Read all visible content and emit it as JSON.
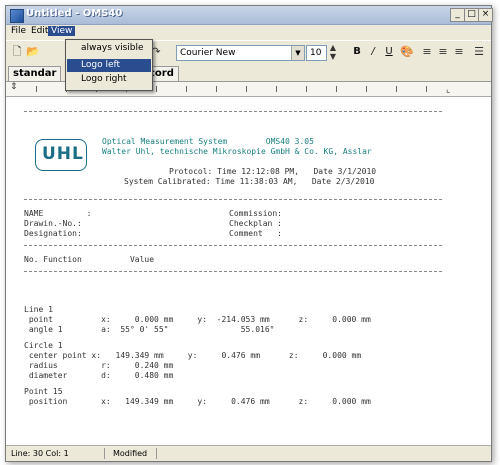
{
  "window": {
    "title": "Untitled - OMS40"
  },
  "window_buttons": [
    "_",
    "□",
    "×"
  ],
  "menu": {
    "file": "File",
    "edit": "Edit",
    "view": "View"
  },
  "view_menu": {
    "items": [
      "always visible",
      "Logo left",
      "Logo right"
    ],
    "highlighted_index": 1
  },
  "toolbar": {
    "font": "Courier New",
    "size": "10",
    "bold": "B",
    "italic": "/",
    "underline": "U"
  },
  "tabs": [
    "standar",
    "cord"
  ],
  "document": {
    "header_title": "Optical Measurement System        OMS40 3.05",
    "header_company": "Walter Uhl, technische Mikroskopie GmbH & Co. KG, Asslar",
    "logo_text": "UHL",
    "protocol_line": "Protocol: Time 12:12:08 PM,   Date 3/1/2010",
    "calibrated_line": "System Calibrated: Time 11:38:03 AM,   Date 2/3/2010",
    "fields_left": [
      "NAME         :",
      "Drawin.-No.:",
      "Designation:"
    ],
    "fields_right": [
      "Commission:",
      "Checkplan :",
      "Comment   :"
    ],
    "columns": "No. Function          Value",
    "rows": [
      "Line 1",
      " point          x:     0.000 mm     y:  -214.053 mm      z:     0.000 mm",
      " angle 1        a:  55° 0' 55\"               55.016°",
      "Circle 1",
      " center point x:   149.349 mm     y:     0.476 mm      z:     0.000 mm",
      " radius         r:     0.240 mm",
      " diameter       d:     0.480 mm",
      "Point 15",
      " position       x:   149.349 mm     y:     0.476 mm      z:     0.000 mm"
    ]
  },
  "status": {
    "position": "Line: 30  Col: 1",
    "state": "Modified"
  }
}
